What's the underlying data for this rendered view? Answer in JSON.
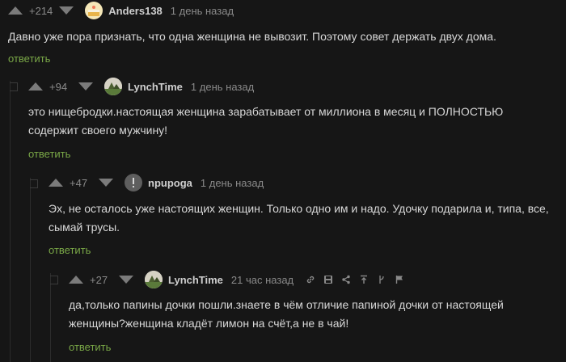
{
  "comments": [
    {
      "rating": "+214",
      "username": "Anders138",
      "time": "1 день назад",
      "text": "Давно уже пора признать, что одна женщина не вывозит. Поэтому совет держать двух дома.",
      "reply": "ответить"
    },
    {
      "rating": "+94",
      "username": "LynchTime",
      "time": "1 день назад",
      "text": "это нищебродки.настоящая женщина зарабатывает от миллиона в месяц и ПОЛНОСТЬЮ содержит своего мужчину!",
      "reply": "ответить"
    },
    {
      "rating": "+47",
      "username": "npupoga",
      "time": "1 день назад",
      "text": "Эх, не осталось уже настоящих женщин. Только одно им и надо. Удочку подарила и, типа, все, сымай трусы.",
      "reply": "ответить"
    },
    {
      "rating": "+27",
      "username": "LynchTime",
      "time": "21 час назад",
      "text": "да,только папины дочки пошли.знаете в чём отличие папиной дочки от настоящей женщины?женщина кладёт лимон на счёт,а не в чай!",
      "reply": "ответить"
    }
  ],
  "colors": {
    "background": "#161616",
    "text": "#d8d8d8",
    "muted": "#8a8a8a",
    "reply_link": "#7aa847"
  }
}
